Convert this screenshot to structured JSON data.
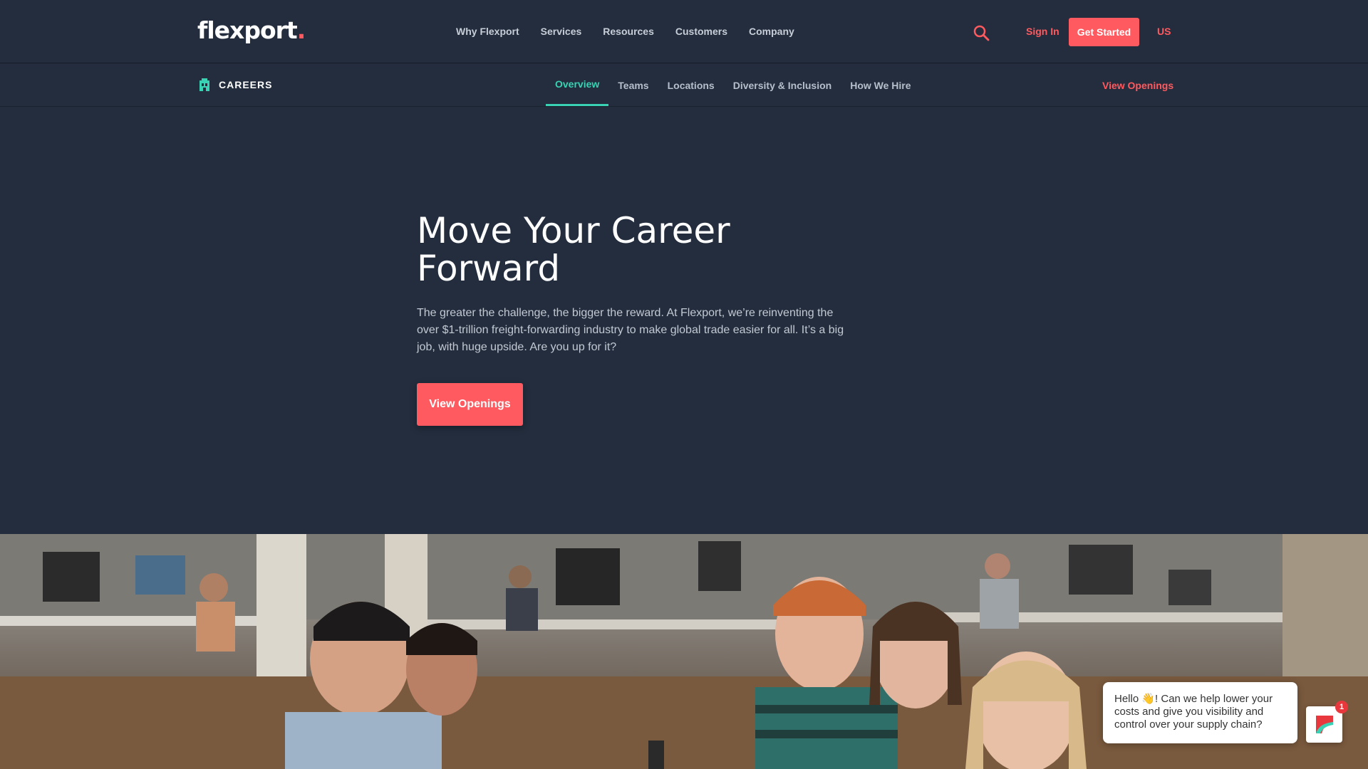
{
  "header": {
    "logo_text": "flexport",
    "logo_dot": ".",
    "nav": [
      "Why Flexport",
      "Services",
      "Resources",
      "Customers",
      "Company"
    ],
    "sign_in": "Sign In",
    "get_started": "Get Started",
    "locale": "US"
  },
  "subnav": {
    "section": "CAREERS",
    "tabs": [
      "Overview",
      "Teams",
      "Locations",
      "Diversity & Inclusion",
      "How We Hire"
    ],
    "active_tab": "Overview",
    "view_openings": "View Openings"
  },
  "hero": {
    "title": "Move Your Career Forward",
    "text": "The greater the challenge, the bigger the reward. At Flexport, we’re reinventing the over $1-trillion freight-forwarding industry to make global trade easier for all. It’s a big job, with huge upside. Are you up for it?",
    "button": "View Openings"
  },
  "chat": {
    "message": "Hello 👋! Can we help lower your costs and give you visibility and control over your supply chain?",
    "badge_count": "1"
  },
  "colors": {
    "background": "#232d3d",
    "accent": "#ff5a5f",
    "active_tab": "#39d2b4"
  }
}
